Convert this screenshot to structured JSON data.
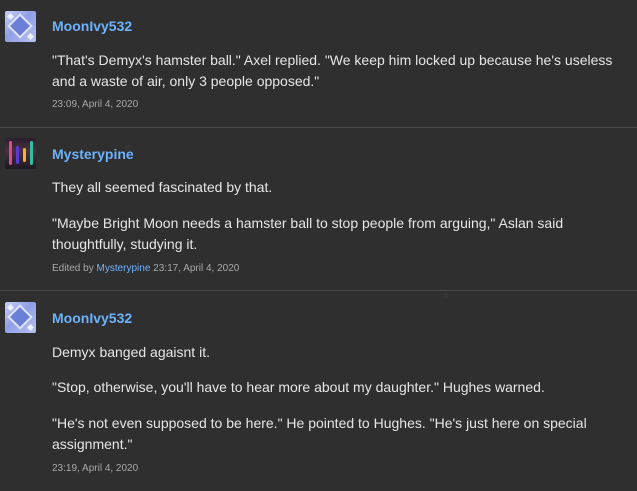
{
  "posts": [
    {
      "username": "MoonIvy532",
      "paragraphs": [
        "\"That's Demyx's hamster ball.\" Axel replied. \"We keep him locked up because he's useless and a waste of air, only 3 people opposed.\""
      ],
      "timestamp": "23:09, April 4, 2020"
    },
    {
      "username": "Mysterypine",
      "paragraphs": [
        "They all seemed fascinated by that.",
        "\"Maybe Bright Moon needs a hamster ball to stop people from arguing,\" Aslan said thoughtfully, studying it."
      ],
      "edited_prefix": "Edited by",
      "edited_by": "Mysterypine",
      "timestamp": "23:17, April 4, 2020"
    },
    {
      "username": "MoonIvy532",
      "paragraphs": [
        "Demyx banged agaisnt it.",
        "\"Stop, otherwise, you'll have to hear more about my daughter.\" Hughes warned.",
        "\"He's not even supposed to be here.\" He pointed to Hughes. \"He's just here on special assignment.\""
      ],
      "timestamp": "23:19, April 4, 2020"
    }
  ]
}
